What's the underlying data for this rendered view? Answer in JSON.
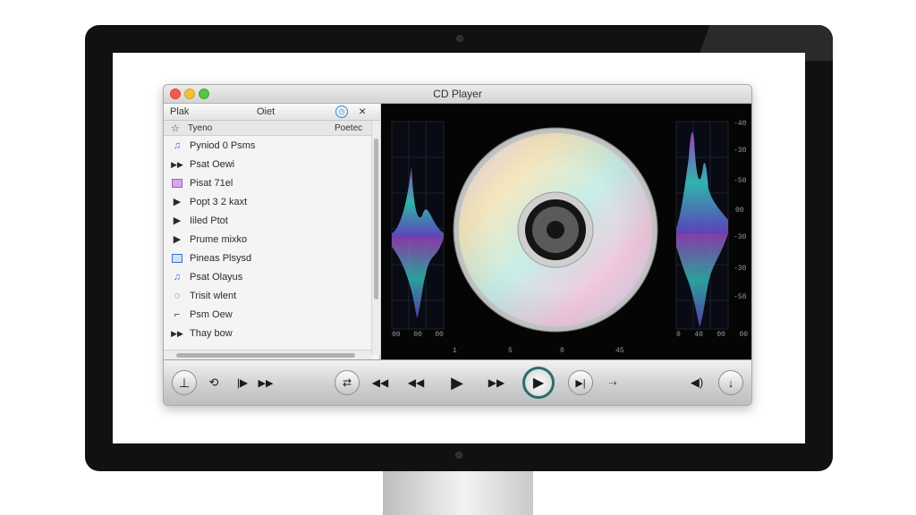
{
  "window": {
    "title": "CD Player"
  },
  "sidebar": {
    "header": {
      "left": "Plak",
      "center": "Oiet",
      "clock_icon": "clock-icon",
      "close_icon": "close-icon"
    },
    "column": {
      "name": "Tyeno",
      "right": "Poetec"
    },
    "items": [
      {
        "icon": "music-note-icon",
        "label": "Pyniod 0 Psms"
      },
      {
        "icon": "fast-forward-icon",
        "label": "Psat Oewi"
      },
      {
        "icon": "playlist-purple-icon",
        "label": "Pisat 71el"
      },
      {
        "icon": "play-icon",
        "label": "Popt 3 2 kaxt"
      },
      {
        "icon": "play-icon",
        "label": "Iiled Ptot"
      },
      {
        "icon": "play-icon",
        "label": "Prume mixko"
      },
      {
        "icon": "playlist-blue-icon",
        "label": "Pineas Plsysd"
      },
      {
        "icon": "music-note-icon",
        "label": "Psat Olayus"
      },
      {
        "icon": "speech-icon",
        "label": "Trisit wlent"
      },
      {
        "icon": "bracket-icon",
        "label": "Psm Oew"
      },
      {
        "icon": "fast-forward-icon",
        "label": "Thay bow"
      }
    ]
  },
  "visualizer": {
    "left_axis_bottom": [
      "00",
      "00",
      "00"
    ],
    "right_axis": [
      "-40",
      "-30",
      "-50",
      "00",
      "-30",
      "-30",
      "-50"
    ],
    "bottom_ticks": [
      "1",
      "5",
      "0",
      "45"
    ],
    "right_bottom": [
      "0",
      "40",
      "00",
      "00"
    ]
  },
  "controls": {
    "buttons": [
      "volume-down-icon",
      "repeat-icon",
      "prev-chapter-icon",
      "fast-forward-icon",
      "shuffle-icon",
      "rewind-icon",
      "rewind-icon",
      "play-icon",
      "fast-forward-icon",
      "play-circle-icon",
      "next-track-icon",
      "arrows-icon",
      "speaker-icon",
      "volume-icon"
    ]
  },
  "colors": {
    "accent": "#2a6d6d",
    "wave_purple": "#b14bd6",
    "wave_cyan": "#37d1c7"
  }
}
